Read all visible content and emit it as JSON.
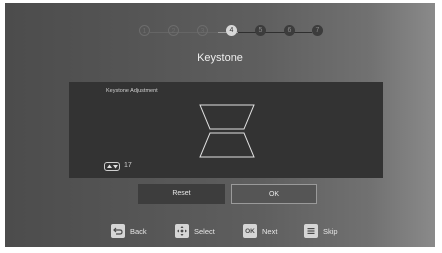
{
  "wizard": {
    "steps": [
      {
        "num": "1",
        "state": "done"
      },
      {
        "num": "2",
        "state": "done"
      },
      {
        "num": "3",
        "state": "done"
      },
      {
        "num": "4",
        "state": "current"
      },
      {
        "num": "5",
        "state": "pending"
      },
      {
        "num": "6",
        "state": "pending"
      },
      {
        "num": "7",
        "state": "pending"
      }
    ],
    "title": "Keystone"
  },
  "panel": {
    "label": "Keystone Adjustment",
    "value": "17",
    "control_icon": "up-down-arrows-icon"
  },
  "buttons": {
    "reset": "Reset",
    "ok": "OK"
  },
  "legend": {
    "back": {
      "icon": "back-icon",
      "label": "Back"
    },
    "select": {
      "icon": "dpad-icon",
      "label": "Select"
    },
    "next": {
      "icon": "ok-key-icon",
      "key_text": "OK",
      "label": "Next"
    },
    "skip": {
      "icon": "menu-icon",
      "label": "Skip"
    }
  },
  "colors": {
    "panel_bg": "#333333",
    "step_current": "#d8d8d8",
    "step_pending": "#3c3c3c",
    "ok_border": "#9a9a9a"
  }
}
